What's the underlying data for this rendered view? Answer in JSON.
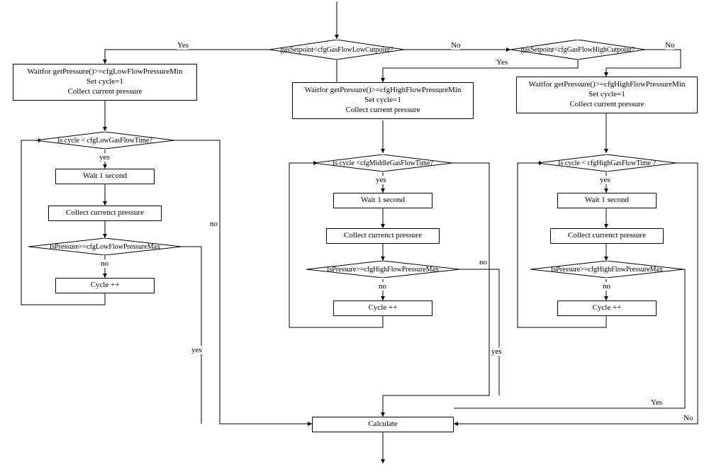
{
  "labels": {
    "yes": "Yes",
    "no": "No",
    "yes_lc": "yes",
    "no_lc": "no"
  },
  "top": {
    "d1": "gasSetpoint<cfgGasFlowLowCutpoint?",
    "d2": "gasSetpoint<cfgGasFlowHighCutpoint?"
  },
  "left": {
    "init_l1": "Waitfor getPressure()>=cfgLowFlowPressureMin",
    "init_l2": "Set cycle=1",
    "init_l3": "Collect current pressure",
    "loop_cond": "Is cycle <  cfgLowGasFlowTime?",
    "wait": "Wait  1  second",
    "collect": "Collect currenct pressure",
    "press_cond": "IsPressure>=cfgLowFlowPressureMax",
    "cycle_inc": "Cycle ++"
  },
  "middle": {
    "init_l1": "Waitfor getPressure()>=cfgHighFlowPressureMin",
    "init_l2": "Set cycle=1",
    "init_l3": "Collect current pressure",
    "loop_cond": "Is cycle <cfgMiddleGasFlowTime?",
    "wait": "Wait  1  second",
    "collect": "Collect currenct pressure",
    "press_cond": "IsPressure>=cfgHighFlowPressureMax",
    "cycle_inc": "Cycle ++"
  },
  "right": {
    "init_l1": "Waitfor getPressure()>=cfgHighFlowPressureMin",
    "init_l2": "Set cycle=1",
    "init_l3": "Collect current pressure",
    "loop_cond": "Is cycle < cfgHighGasFlowTime ?",
    "wait": "Wait  1  second",
    "collect": "Collect currenct pressure",
    "press_cond": "IsPressure>=cfgHighFlowPressureMax",
    "cycle_inc": "Cycle ++"
  },
  "bottom": {
    "calculate": "Calculate"
  }
}
